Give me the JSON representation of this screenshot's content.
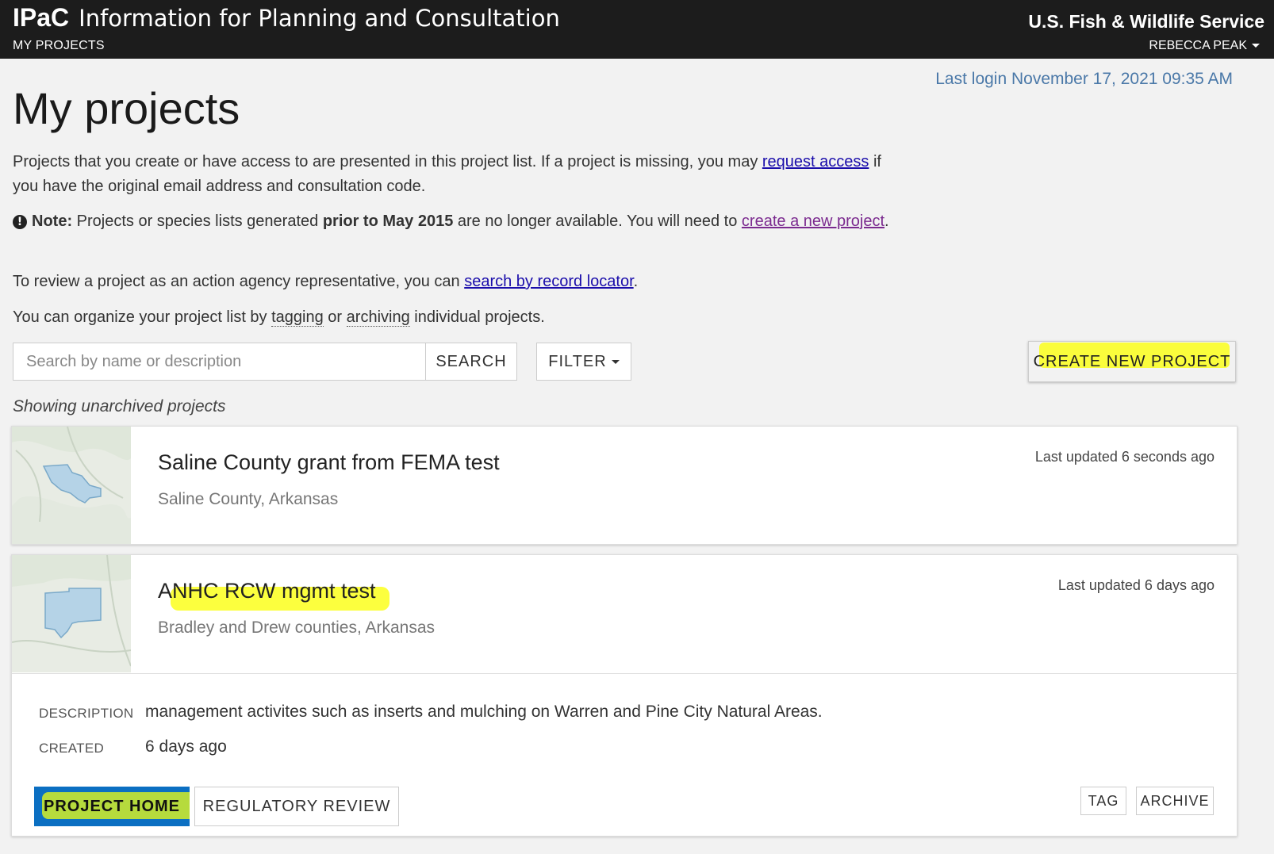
{
  "header": {
    "brand_short": "IPaC",
    "brand_long": "Information for Planning and Consultation",
    "nav_my_projects": "MY PROJECTS",
    "agency": "U.S. Fish & Wildlife Service",
    "user": "REBECCA PEAK"
  },
  "page": {
    "last_login": "Last login November 17, 2021 09:35 AM",
    "title": "My projects",
    "intro_text_1": "Projects that you create or have access to are presented in this project list. If a project is missing, you may ",
    "intro_link": "request access",
    "intro_text_2": " if you have the original email address and consultation code.",
    "note_label": "Note:",
    "note_text_1": " Projects or species lists generated ",
    "note_bold": "prior to May 2015",
    "note_text_2": " are no longer available. You will need to ",
    "note_link": "create a new project",
    "note_end": ".",
    "review_text": "To review a project as an action agency representative, you can ",
    "review_link": "search by record locator",
    "review_end": ".",
    "organize_1": "You can organize your project list by ",
    "organize_tagging": "tagging",
    "organize_2": " or ",
    "organize_archiving": "archiving",
    "organize_3": " individual projects."
  },
  "toolbar": {
    "search_placeholder": "Search by name or description",
    "search_label": "SEARCH",
    "filter_label": "FILTER",
    "create_label": "CREATE NEW PROJECT"
  },
  "list": {
    "showing": "Showing unarchived projects",
    "projects": [
      {
        "name": "Saline County grant from FEMA test",
        "location": "Saline County, Arkansas",
        "updated": "Last updated 6 seconds ago"
      },
      {
        "name": "ANHC RCW mgmt test",
        "location": "Bradley and Drew counties, Arkansas",
        "updated": "Last updated 6 days ago",
        "description_label": "DESCRIPTION",
        "description": "management activites such as inserts and mulching on Warren and Pine City Natural Areas.",
        "created_label": "CREATED",
        "created": "6 days ago",
        "project_home_label": "PROJECT HOME",
        "regulatory_review_label": "REGULATORY REVIEW",
        "tag_label": "TAG",
        "archive_label": "ARCHIVE"
      }
    ]
  },
  "colors": {
    "header_bg": "#1c1c1c",
    "link": "#1a0dab",
    "visited_link": "#7b2a8f",
    "last_login": "#4a78a8",
    "primary_button": "#0b6fc2",
    "highlight": "#fbff1c"
  }
}
